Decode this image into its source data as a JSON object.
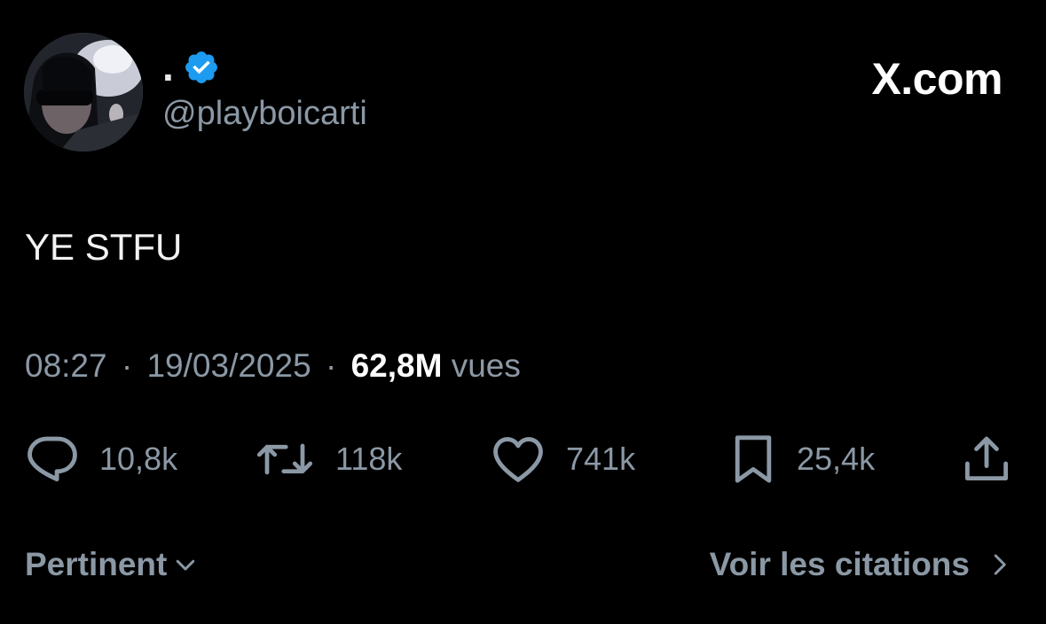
{
  "author": {
    "display_name": ".",
    "handle": "@playboicarti",
    "verified": true,
    "verified_color": "#1d9bf0"
  },
  "brand": "X.com",
  "tweet": {
    "text": "YE STFU",
    "time": "08:27",
    "date": "19/03/2025",
    "separator": "·",
    "views_count": "62,8M",
    "views_label": "vues"
  },
  "actions": {
    "replies": "10,8k",
    "reposts": "118k",
    "likes": "741k",
    "bookmarks": "25,4k"
  },
  "footer": {
    "sort_label": "Pertinent",
    "quotes_label": "Voir les citations"
  },
  "icons": {
    "reply": "reply-icon",
    "repost": "repost-icon",
    "like": "heart-icon",
    "bookmark": "bookmark-icon",
    "share": "share-icon",
    "verified": "verified-badge-icon",
    "sort": "chevron-down-icon",
    "quotes": "chevron-right-icon"
  },
  "colors": {
    "background": "#000000",
    "text": "#e7e9ea",
    "muted": "#8b98a5",
    "accent": "#1d9bf0"
  }
}
